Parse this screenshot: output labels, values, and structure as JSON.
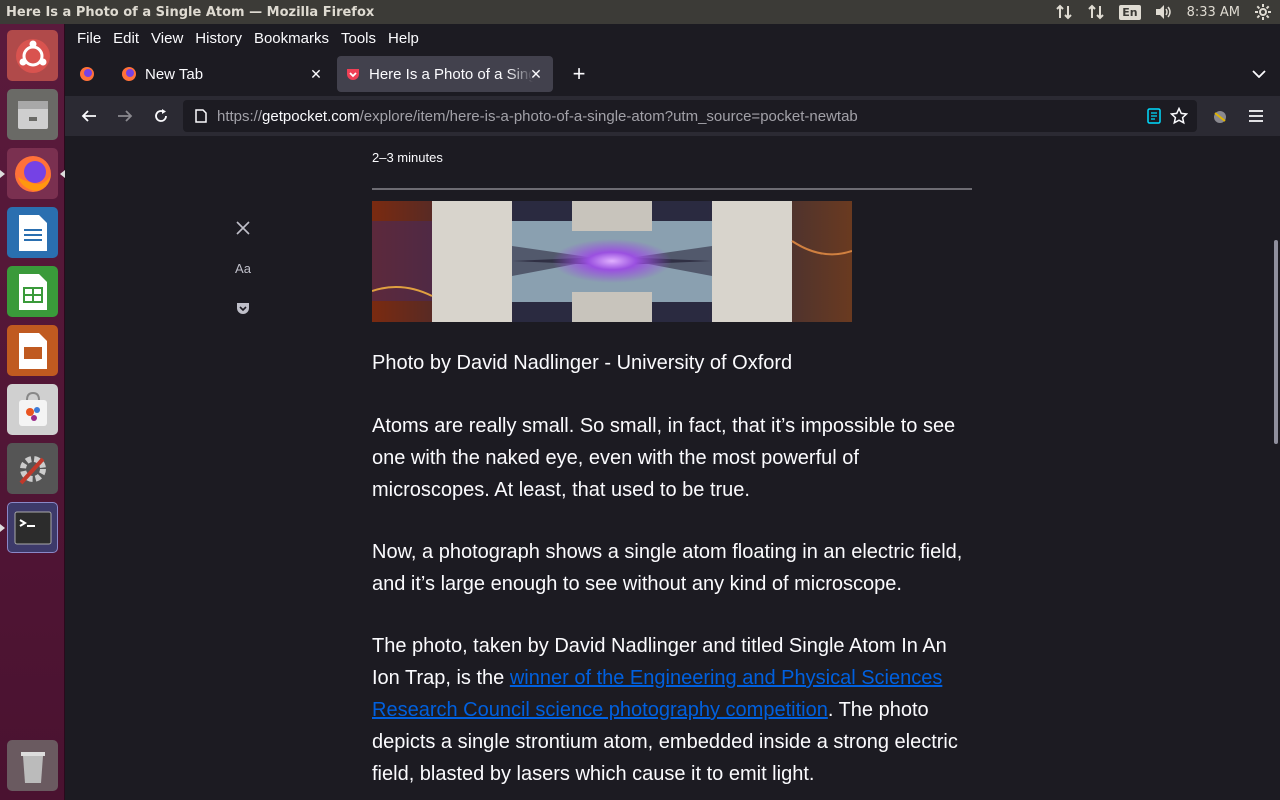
{
  "top_panel": {
    "window_title": "Here Is a Photo of a Single Atom — Mozilla Firefox",
    "language": "En",
    "clock": "8:33 AM"
  },
  "menu": {
    "file": "File",
    "edit": "Edit",
    "view": "View",
    "history": "History",
    "bookmarks": "Bookmarks",
    "tools": "Tools",
    "help": "Help"
  },
  "tabs": [
    {
      "label": "New Tab"
    },
    {
      "label": "Here Is a Photo of a Single Atom"
    }
  ],
  "url": {
    "scheme": "https://",
    "host": "getpocket.com",
    "path": "/explore/item/here-is-a-photo-of-a-single-atom?utm_source=pocket-newtab"
  },
  "article": {
    "reading_time": "2–3 minutes",
    "reader_font_label": "Aa",
    "caption": "Photo by David Nadlinger - University of Oxford",
    "p1": "Atoms are really small. So small, in fact, that it’s impossible to see one with the naked eye, even with the most powerful of microscopes. At least, that used to be true.",
    "p2": "Now, a photograph shows a single atom floating in an electric field, and it’s large enough to see without any kind of microscope.",
    "p3_before": "The photo, taken by David Nadlinger and titled Single Atom In An Ion Trap, is the ",
    "p3_link": "winner of the Engineering and Physical Sciences Research Council science photography competition",
    "p3_after": ". The photo depicts a single strontium atom, embedded inside a strong electric field, blasted by lasers which cause it to emit light."
  },
  "colors": {
    "launcher": "#5a1a3c",
    "panel": "#3c3b37",
    "browser_bg": "#1c1b22",
    "toolbar": "#2b2a33",
    "link": "#0060df"
  }
}
